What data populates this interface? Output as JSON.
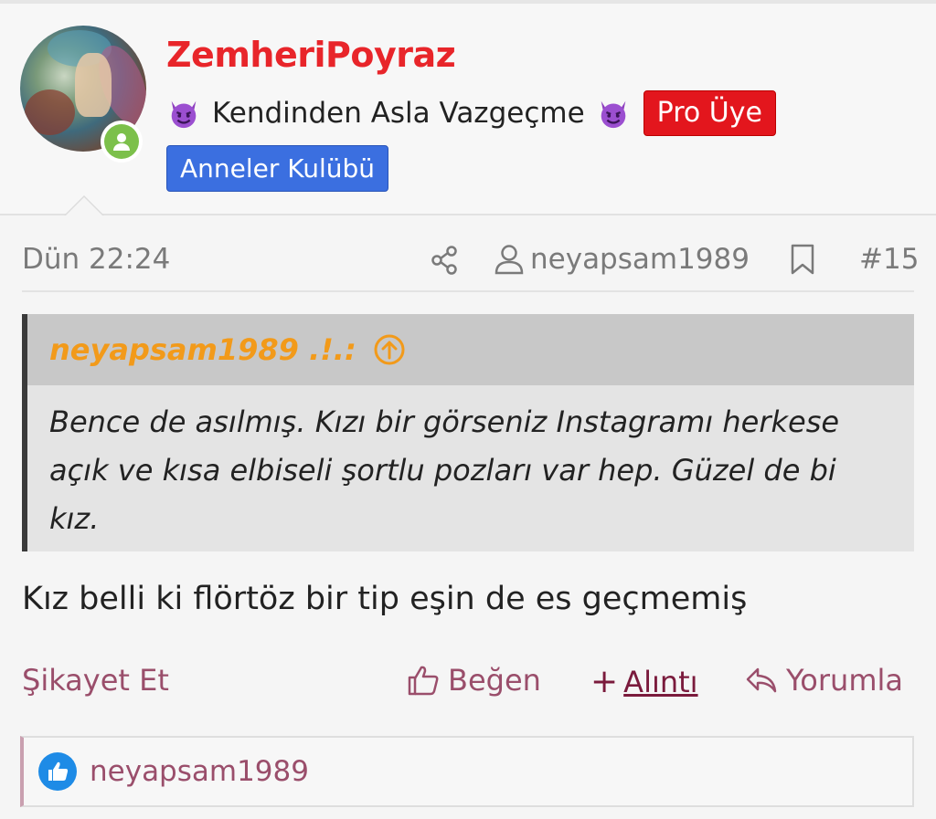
{
  "post": {
    "author": {
      "username": "ZemheriPoyraz",
      "motto": "Kendinden Asla Vazgeçme",
      "rank_badge": "Pro Üye",
      "group_badge": "Anneler Kulübü",
      "online": true
    },
    "meta": {
      "date": "Dün 22:24",
      "mentioned_user": "neyapsam1989",
      "post_number": "#15"
    },
    "quote": {
      "author": "neyapsam1989 .!.:",
      "text": "Bence de asılmış. Kızı bir görseniz Instagramı herkese açık ve kısa elbiseli şortlu pozları var hep. Güzel de bi kız."
    },
    "body": "Kız belli ki flörtöz bir tip eşin de es geçmemiş",
    "actions": {
      "report": "Şikayet Et",
      "like": "Beğen",
      "quote_plus": "+",
      "quote": "Alıntı",
      "reply": "Yorumla"
    },
    "reactions": {
      "user": "neyapsam1989"
    }
  },
  "colors": {
    "username": "#e8252a",
    "pro_badge": "#e3161d",
    "group_badge": "#3b6fe0",
    "quote_author": "#f29a1a",
    "action_text": "#9a4e6b",
    "online": "#7cc04b",
    "like_icon": "#1e8be6"
  },
  "icons": [
    "devil-emoji-icon",
    "online-status-icon",
    "share-icon",
    "user-icon",
    "bookmark-icon",
    "arrow-up-circle-icon",
    "thumbs-up-icon",
    "reply-icon"
  ]
}
